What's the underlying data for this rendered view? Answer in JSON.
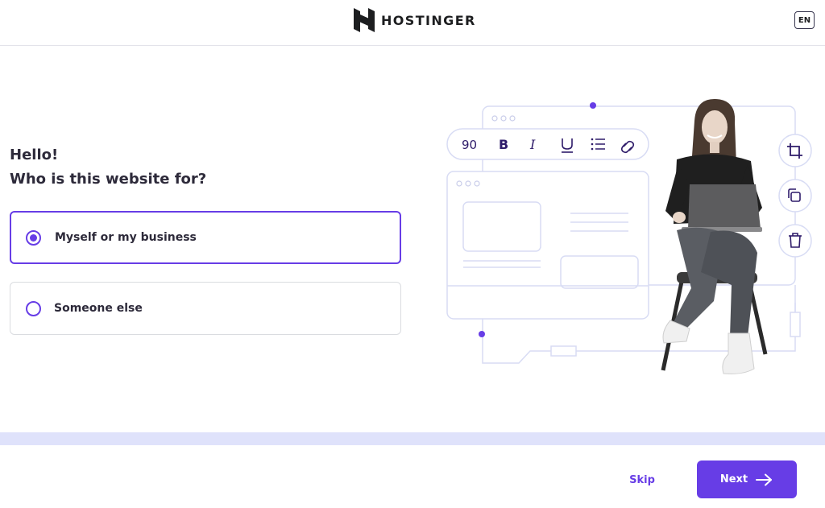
{
  "header": {
    "brand": "HOSTINGER",
    "language": "EN"
  },
  "main": {
    "greeting": "Hello!",
    "question": "Who is this website for?",
    "options": [
      {
        "label": "Myself or my business",
        "selected": true
      },
      {
        "label": "Someone else",
        "selected": false
      }
    ]
  },
  "illustration": {
    "toolbar": {
      "font_size": "90"
    }
  },
  "footer": {
    "skip_label": "Skip",
    "next_label": "Next"
  },
  "icons": [
    "hostinger-logo-icon",
    "radio-checked-icon",
    "radio-unchecked-icon",
    "bold-icon",
    "italic-icon",
    "underline-icon",
    "list-icon",
    "link-icon",
    "crop-icon",
    "copy-icon",
    "trash-icon",
    "arrow-right-icon"
  ],
  "colors": {
    "accent": "#673de6",
    "text": "#2d2a3a",
    "progress_track": "#dfe2fb",
    "border": "#dadce0"
  }
}
